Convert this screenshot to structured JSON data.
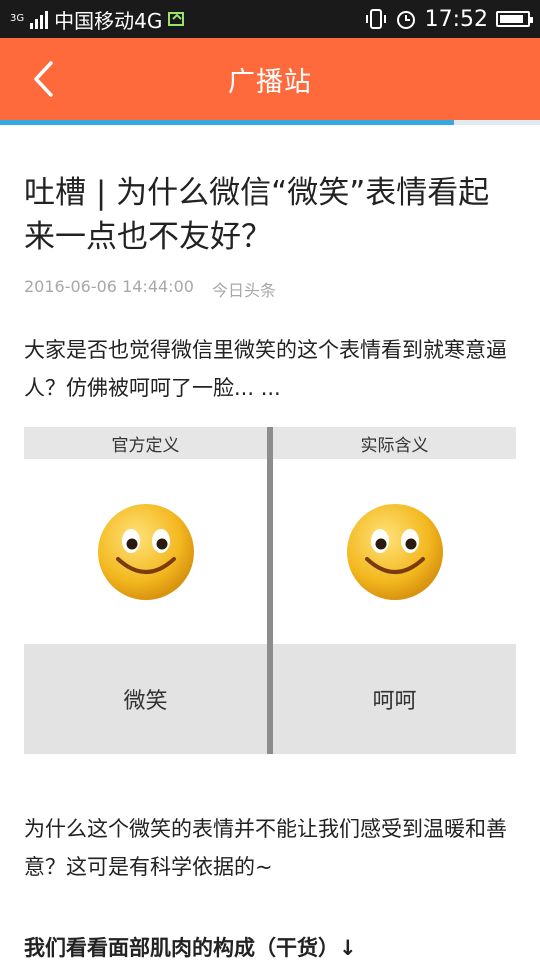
{
  "status_bar": {
    "network_badge": "3G",
    "carrier": "中国移动4G",
    "time": "17:52",
    "battery_level": 0.9
  },
  "header": {
    "title": "广播站",
    "back_icon": "chevron-left-icon",
    "reading_progress": 0.84
  },
  "article": {
    "title": "吐槽 | 为什么微信“微笑”表情看起来一点也不友好？",
    "date": "2016-06-06 14:44:00",
    "source": "今日头条",
    "intro": "大家是否也觉得微信里微笑的这个表情看到就寒意逼人？仿佛被呵呵了一脸... ...",
    "figure": {
      "left_caption": "官方定义",
      "left_label": "微笑",
      "right_caption": "实际含义",
      "right_label": "呵呵"
    },
    "para2": "为什么这个微笑的表情并不能让我们感受到温暖和善意？这可是有科学依据的~",
    "subhead": "我们看看面部肌肉的构成（干货）↓"
  },
  "colors": {
    "header_bg": "#ff6a3d",
    "progress": "#35a9e0",
    "meta_text": "#a8a8a8"
  }
}
